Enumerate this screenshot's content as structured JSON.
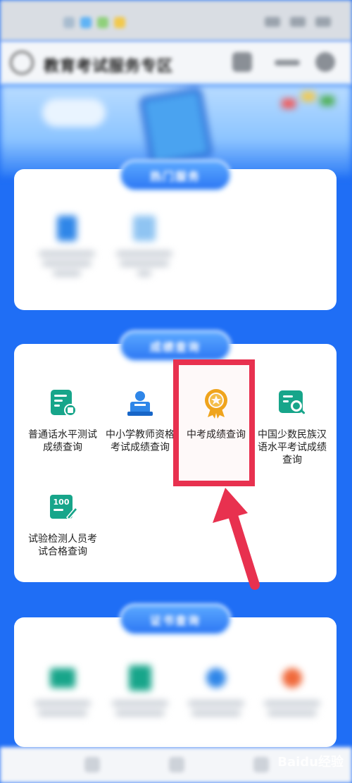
{
  "header": {
    "title": "教育考试服务专区"
  },
  "section1": {
    "title": "热门服务",
    "items": [
      {
        "label": "热门服务一",
        "icon": "document-icon"
      },
      {
        "label": "热门服务二",
        "icon": "certificate-icon"
      }
    ]
  },
  "section2": {
    "title": "成绩查询",
    "items": [
      {
        "label": "普通话水平测试成绩查询",
        "icon": "report-icon"
      },
      {
        "label": "中小学教师资格考试成绩查询",
        "icon": "teacher-icon"
      },
      {
        "label": "中考成绩查询",
        "icon": "medal-icon"
      },
      {
        "label": "中国少数民族汉语水平考试成绩查询",
        "icon": "search-document-icon"
      },
      {
        "label": "试验检测人员考试合格查询",
        "icon": "score-100-icon"
      }
    ],
    "score_icon_text": "100"
  },
  "section3": {
    "title": "证书查询"
  },
  "watermark": "Baidu经验",
  "colors": {
    "primary_blue": "#1f6ef5",
    "highlight_red": "#e8314f",
    "icon_teal": "#17a58a",
    "icon_blue": "#2f86e8",
    "medal_gold": "#f0a81c"
  }
}
